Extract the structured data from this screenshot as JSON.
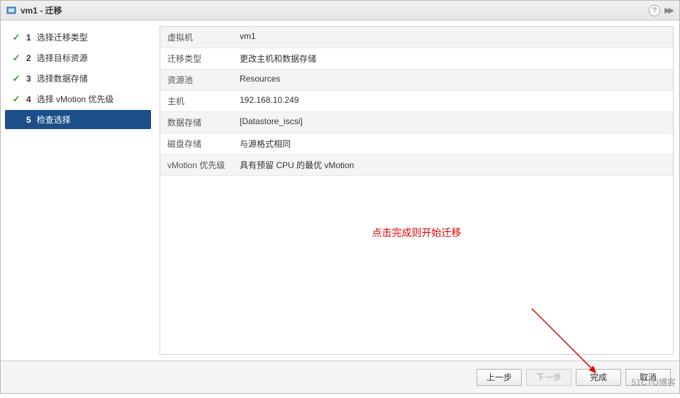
{
  "titlebar": {
    "title": "vm1 - 迁移",
    "help_tooltip": "?"
  },
  "steps": [
    {
      "num": "1",
      "label": "选择迁移类型",
      "done": true,
      "active": false
    },
    {
      "num": "2",
      "label": "选择目标资源",
      "done": true,
      "active": false
    },
    {
      "num": "3",
      "label": "选择数据存储",
      "done": true,
      "active": false
    },
    {
      "num": "4",
      "label": "选择 vMotion 优先级",
      "done": true,
      "active": false
    },
    {
      "num": "5",
      "label": "检查选择",
      "done": false,
      "active": true
    }
  ],
  "summary": [
    {
      "label": "虚拟机",
      "value": "vm1"
    },
    {
      "label": "迁移类型",
      "value": "更改主机和数据存储"
    },
    {
      "label": "资源池",
      "value": "Resources"
    },
    {
      "label": "主机",
      "value": "192.168.10.249"
    },
    {
      "label": "数据存储",
      "value": "[Datastore_iscsi]"
    },
    {
      "label": "磁盘存储",
      "value": "与源格式相同"
    },
    {
      "label": "vMotion 优先级",
      "value": "具有预留 CPU 的最优 vMotion"
    }
  ],
  "annotation": "点击完成则开始迁移",
  "footer": {
    "back": "上一步",
    "next": "下一步",
    "finish": "完成",
    "cancel": "取消"
  },
  "watermark": "51CTO博客"
}
